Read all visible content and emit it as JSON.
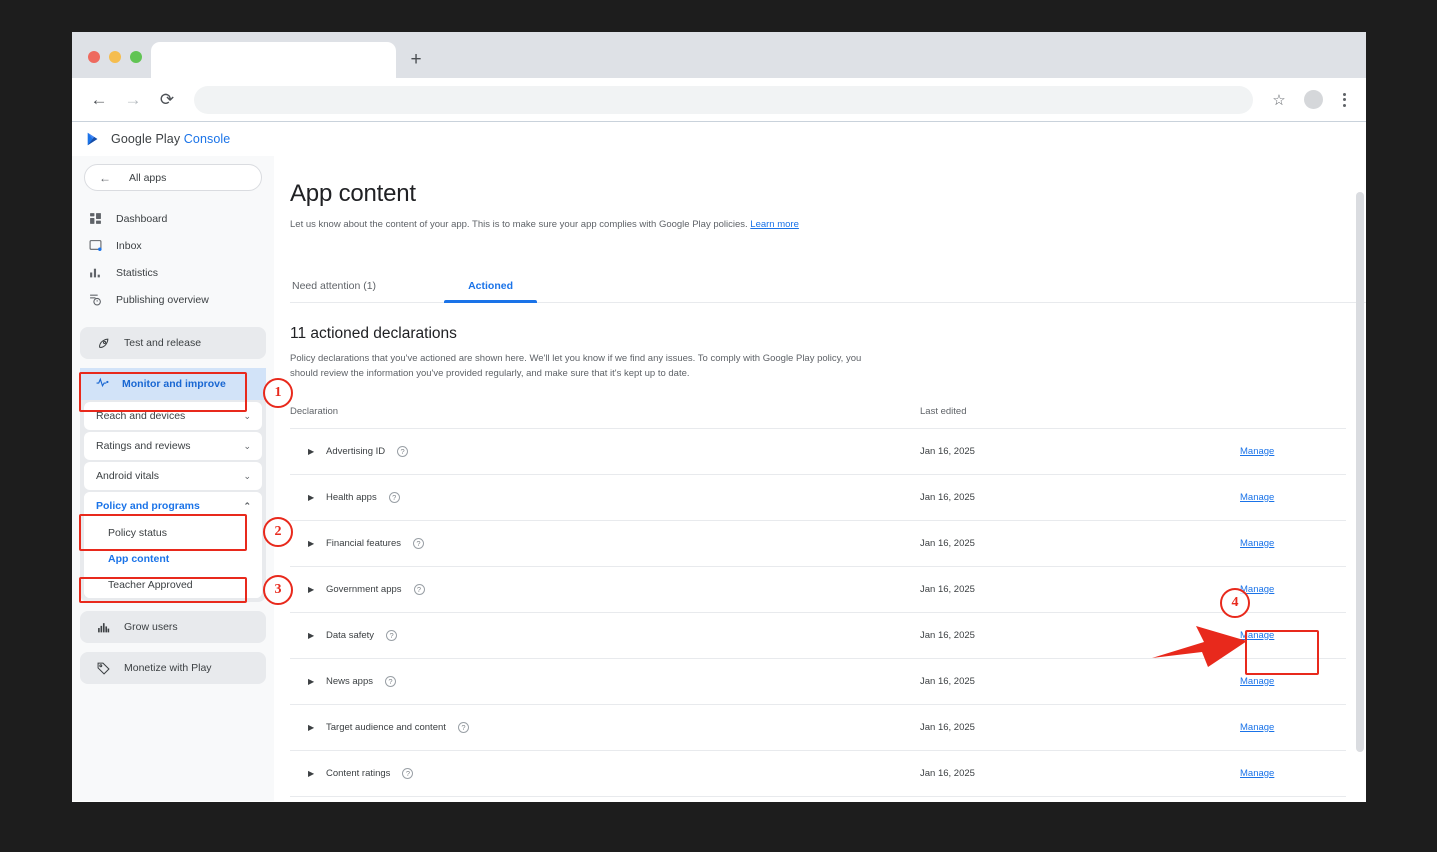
{
  "browser": {
    "new_tab_label": "+",
    "back_icon": "back-arrow-icon",
    "forward_icon": "forward-arrow-icon",
    "reload_icon": "reload-icon",
    "bookmark_icon": "star-icon",
    "menu_icon": "kebab-menu-icon",
    "address_value": "",
    "address_placeholder": ""
  },
  "brand": {
    "name": "Google Play ",
    "product": "Console"
  },
  "sidebar": {
    "back_label": "All apps",
    "primary": [
      {
        "label": "Dashboard",
        "icon": "dashboard-icon"
      },
      {
        "label": "Inbox",
        "icon": "inbox-icon"
      },
      {
        "label": "Statistics",
        "icon": "statistics-icon"
      },
      {
        "label": "Publishing overview",
        "icon": "publishing-overview-icon"
      }
    ],
    "test_and_release": {
      "label": "Test and release",
      "icon": "rocket-icon"
    },
    "monitor_and_improve": {
      "label": "Monitor and improve",
      "icon": "pulse-icon"
    },
    "collapsible": [
      {
        "label": "Reach and devices",
        "chevron": "⌄"
      },
      {
        "label": "Ratings and reviews",
        "chevron": "⌄"
      },
      {
        "label": "Android vitals",
        "chevron": "⌄"
      }
    ],
    "policy_group": {
      "label": "Policy and programs",
      "chevron": "⌃",
      "children": [
        {
          "label": "Policy status",
          "selected": false
        },
        {
          "label": "App content",
          "selected": true
        },
        {
          "label": "Teacher Approved",
          "selected": false
        }
      ]
    },
    "grow_users": {
      "label": "Grow users",
      "icon": "grow-users-icon"
    },
    "monetize": {
      "label": "Monetize with Play",
      "icon": "tag-icon"
    }
  },
  "main": {
    "title": "App content",
    "subtitle": "Let us know about the content of your app. This is to make sure your app complies with Google Play policies. ",
    "subtitle_link": "Learn more",
    "tabs": [
      {
        "label": "Need attention (1)",
        "active": false
      },
      {
        "label": "Actioned",
        "active": true
      }
    ],
    "section_title": "11 actioned declarations",
    "section_desc": "Policy declarations that you've actioned are shown here. We'll let you know if we find any issues. To comply with Google Play policy, you should review the information you've provided regularly, and make sure that it's kept up to date.",
    "table": {
      "headers": [
        "Declaration",
        "Last edited",
        ""
      ],
      "manage_label": "Manage",
      "help_icon": "help-circle-icon",
      "expand_icon": "expand-caret-icon",
      "rows": [
        {
          "declaration": "Advertising ID",
          "last_edited": "Jan 16, 2025"
        },
        {
          "declaration": "Health apps",
          "last_edited": "Jan 16, 2025"
        },
        {
          "declaration": "Financial features",
          "last_edited": "Jan 16, 2025"
        },
        {
          "declaration": "Government apps",
          "last_edited": "Jan 16, 2025"
        },
        {
          "declaration": "Data safety",
          "last_edited": "Jan 16, 2025"
        },
        {
          "declaration": "News apps",
          "last_edited": "Jan 16, 2025"
        },
        {
          "declaration": "Target audience and content",
          "last_edited": "Jan 16, 2025"
        },
        {
          "declaration": "Content ratings",
          "last_edited": "Jan 16, 2025"
        }
      ]
    }
  },
  "annotations": {
    "color": "#e8291c",
    "steps": [
      {
        "number": "1",
        "target": "Monitor and improve"
      },
      {
        "number": "2",
        "target": "Policy and programs"
      },
      {
        "number": "3",
        "target": "App content"
      },
      {
        "number": "4",
        "target": "Manage (Data safety)"
      }
    ]
  },
  "colors": {
    "accent": "#1a73e8",
    "annotation": "#e8291c",
    "sidebar_bg": "#f8f9fa"
  }
}
